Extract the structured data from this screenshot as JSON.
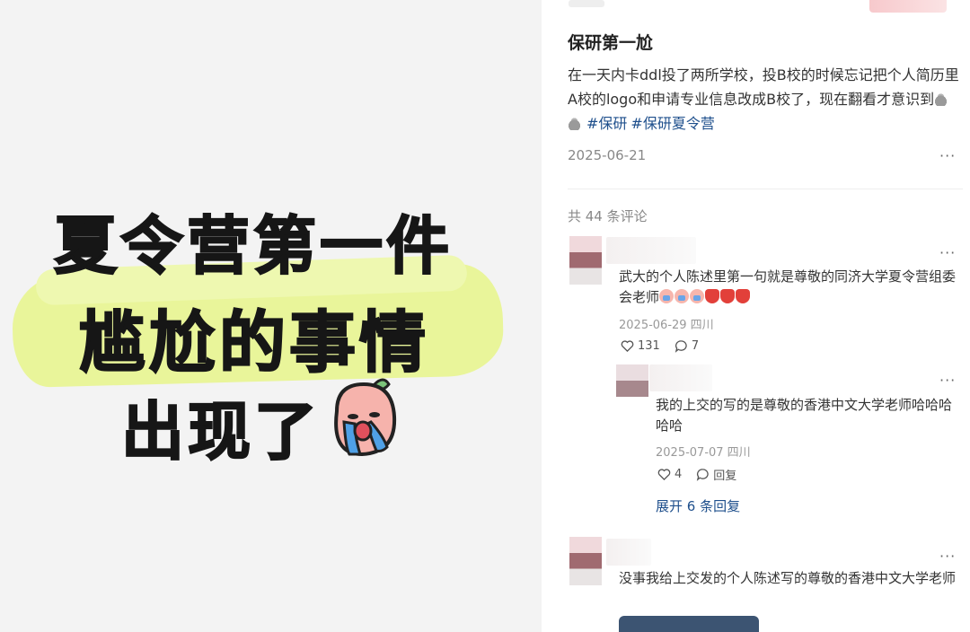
{
  "image": {
    "line1": "夏令营第一件",
    "line2": "尴尬的事情",
    "line3": "出现了",
    "highlight_color": "#e9f59a",
    "sticker_icon": "crying-peach-sticker"
  },
  "post": {
    "title": "保研第一尬",
    "body": "在一天内卡ddl投了两所学校，投B校的时候忘记把个人简历里A校的logo和申请专业信息改成B校了，现在翻看才意识到",
    "tags": [
      "#保研",
      "#保研夏令营"
    ],
    "date": "2025-06-21",
    "more_label": "···"
  },
  "comments_header": {
    "count_label": "共 44 条评论"
  },
  "comments": [
    {
      "text": "武大的个人陈述里第一句就是尊敬的同济大学夏令营组委会老师",
      "meta": "2025-06-29 四川",
      "likes": "131",
      "replies": "7",
      "more_label": "···"
    },
    {
      "text": "我的上交的写的是尊敬的香港中文大学老师哈哈哈哈哈",
      "meta": "2025-07-07 四川",
      "likes": "4",
      "reply_label": "回复",
      "more_label": "···"
    },
    {
      "expand_label": "展开 6 条回复"
    },
    {
      "text": "没事我给上交发的个人陈述写的尊敬的香港中文大学老师",
      "more_label": "···"
    }
  ],
  "colors": {
    "link": "#1e4f8c",
    "meta": "#999999"
  }
}
